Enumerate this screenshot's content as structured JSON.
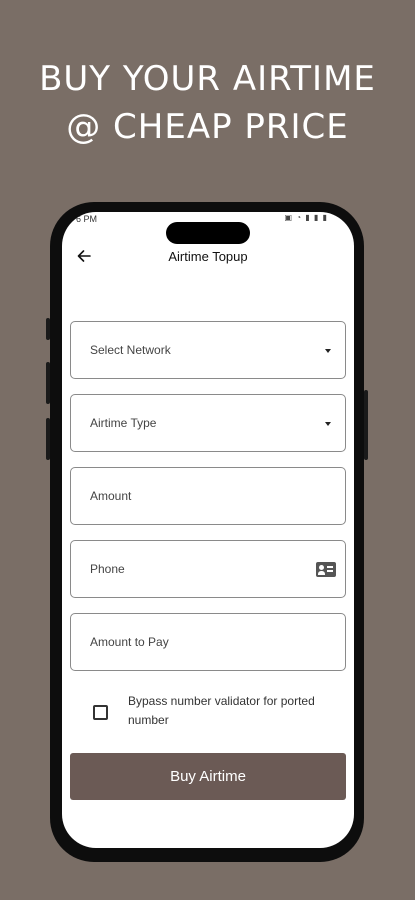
{
  "promo": {
    "headline_line1": "BUY YOUR AIRTIME",
    "headline_line2": "@ CHEAP PRICE"
  },
  "status_bar": {
    "time": "6 PM",
    "icons": "▣ ◔ ▮ ▮ ▮"
  },
  "app_bar": {
    "back_icon": "arrow-left-icon",
    "title": "Airtime Topup"
  },
  "form": {
    "network_label": "Select Network",
    "airtime_type_label": "Airtime Type",
    "amount_label": "Amount",
    "phone_label": "Phone",
    "amount_to_pay_label": "Amount to Pay",
    "bypass_checkbox_label": "Bypass number validator for ported number",
    "bypass_checked": false,
    "submit_label": "Buy Airtime"
  },
  "colors": {
    "background": "#7a6e66",
    "button": "#6b5a55",
    "text_on_button": "#ffffff"
  }
}
